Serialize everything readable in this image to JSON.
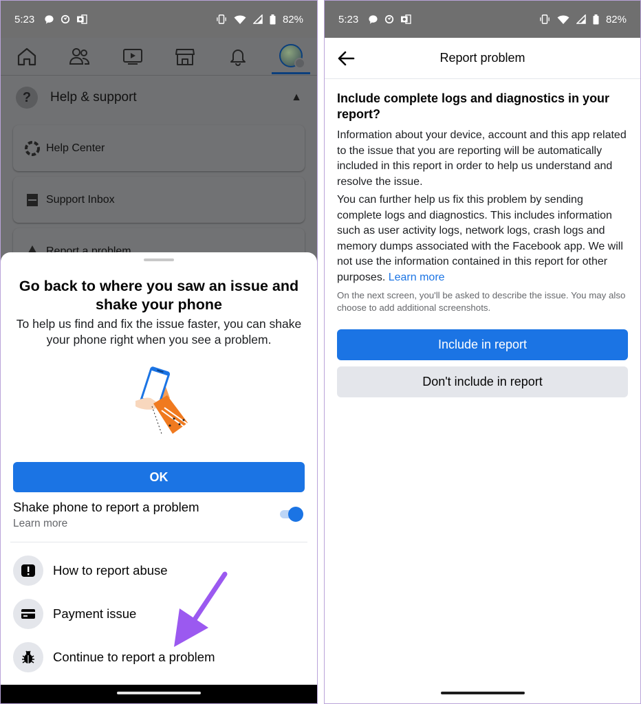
{
  "status": {
    "time": "5:23",
    "battery": "82%"
  },
  "left": {
    "help": {
      "title": "Help & support",
      "items": [
        "Help Center",
        "Support Inbox",
        "Report a problem"
      ]
    },
    "sheet": {
      "title": "Go back to where you saw an issue and shake your phone",
      "description": "To help us find and fix the issue faster, you can shake your phone right when you see a problem.",
      "ok_label": "OK",
      "shake_label": "Shake phone to report a problem",
      "learn_more": "Learn more",
      "shake_enabled": true,
      "options": {
        "abuse": "How to report abuse",
        "payment": "Payment issue",
        "continue": "Continue to report a problem"
      }
    }
  },
  "right": {
    "title": "Report problem",
    "heading": "Include complete logs and diagnostics in your report?",
    "para1": "Information about your device, account and this app related to the issue that you are reporting will be automatically included in this report in order to help us understand and resolve the issue.",
    "para2": "You can further help us fix this problem by sending complete logs and diagnostics. This includes information such as user activity logs, network logs, crash logs and memory dumps associated with the Facebook app. We will not use the information contained in this report for other purposes.",
    "learn_more": "Learn more",
    "note": "On the next screen, you'll be asked to describe the issue. You may also choose to add additional screenshots.",
    "include_label": "Include in report",
    "exclude_label": "Don't include in report"
  },
  "colors": {
    "accent": "#1b74e4",
    "annotation_arrow": "#9b59f0"
  }
}
